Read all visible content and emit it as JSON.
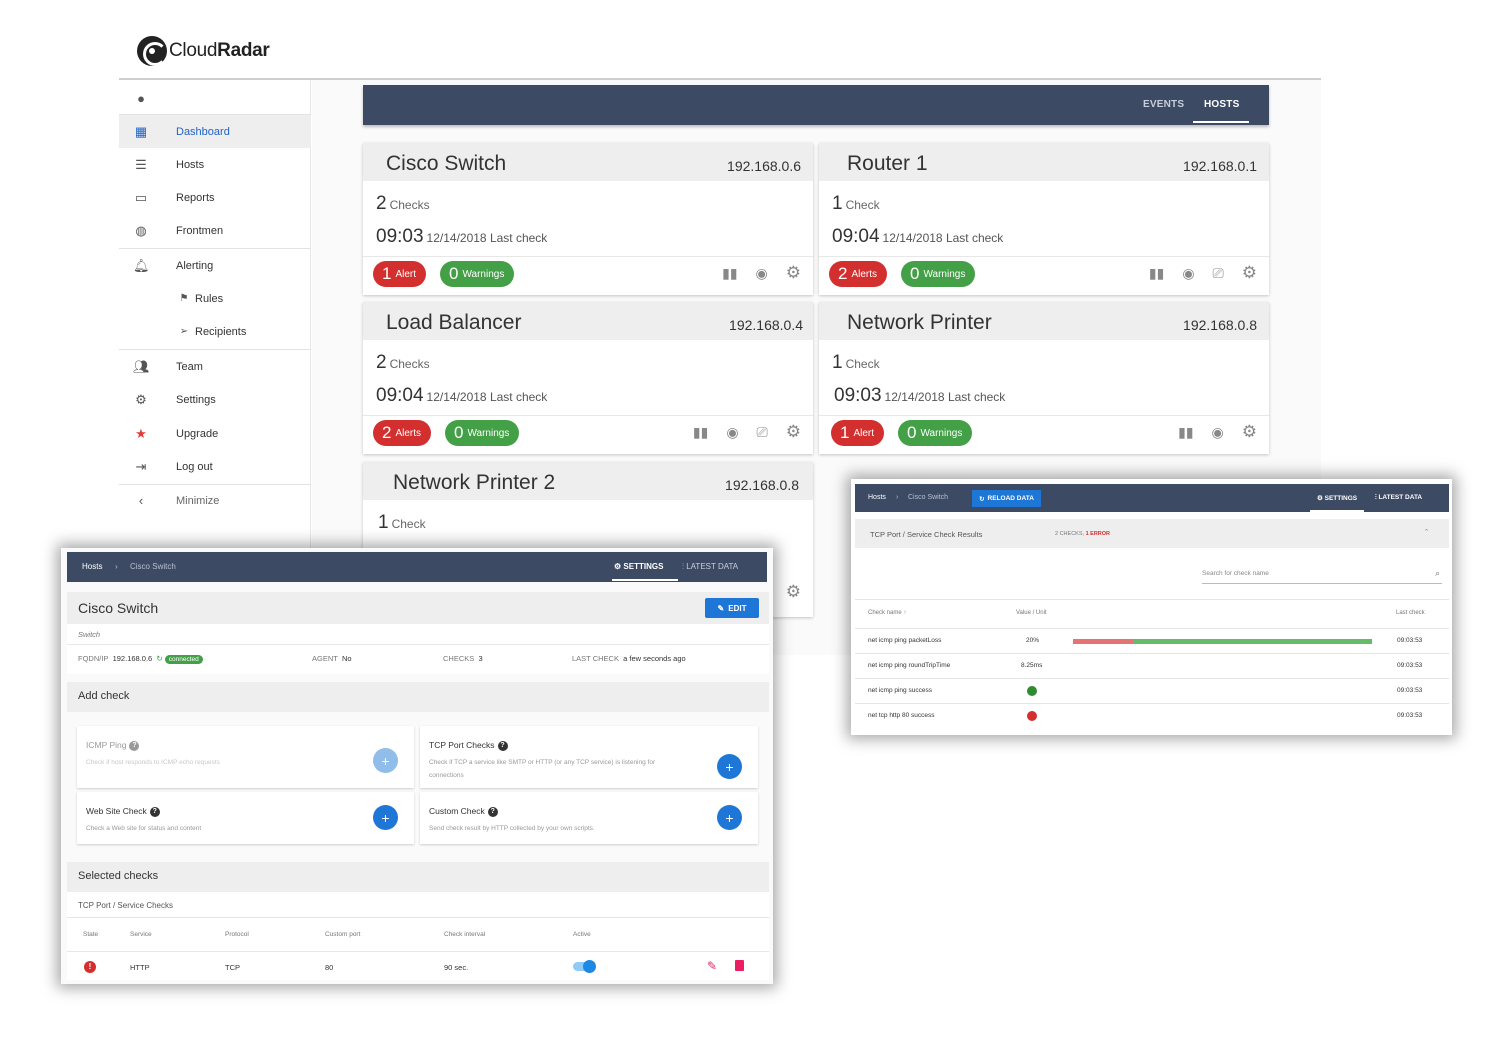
{
  "brand": {
    "name_light": "Cloud",
    "name_bold": "Radar"
  },
  "sidebar": {
    "items": [
      {
        "icon": "account-circle-icon",
        "label": ""
      },
      {
        "icon": "grid-icon",
        "label": "Dashboard"
      },
      {
        "icon": "list-icon",
        "label": "Hosts"
      },
      {
        "icon": "calendar-icon",
        "label": "Reports"
      },
      {
        "icon": "globe-icon",
        "label": "Frontmen"
      },
      {
        "icon": "bell-icon",
        "label": "Alerting"
      },
      {
        "icon": "flag-icon",
        "label": "Rules"
      },
      {
        "icon": "send-icon",
        "label": "Recipients"
      },
      {
        "icon": "people-icon",
        "label": "Team"
      },
      {
        "icon": "gear-icon",
        "label": "Settings"
      },
      {
        "icon": "star-icon",
        "label": "Upgrade"
      },
      {
        "icon": "logout-icon",
        "label": "Log out"
      },
      {
        "icon": "chevron-left-icon",
        "label": "Minimize"
      }
    ]
  },
  "topnav": {
    "events": "EVENTS",
    "hosts": "HOSTS"
  },
  "hosts": [
    {
      "name": "Cisco Switch",
      "ip": "192.168.0.6",
      "checks_n": "2",
      "checks_label": "Checks",
      "time": "09:03",
      "date_label": "12/14/2018 Last check",
      "alerts_n": "1",
      "alerts_label": "Alert",
      "warnings_n": "0",
      "warnings_label": "Warnings"
    },
    {
      "name": "Router 1",
      "ip": "192.168.0.1",
      "checks_n": "1",
      "checks_label": "Check",
      "time": "09:04",
      "date_label": "12/14/2018 Last check",
      "alerts_n": "2",
      "alerts_label": "Alerts",
      "warnings_n": "0",
      "warnings_label": "Warnings"
    },
    {
      "name": "Load Balancer",
      "ip": "192.168.0.4",
      "checks_n": "2",
      "checks_label": "Checks",
      "time": "09:04",
      "date_label": "12/14/2018 Last check",
      "alerts_n": "2",
      "alerts_label": "Alerts",
      "warnings_n": "0",
      "warnings_label": "Warnings"
    },
    {
      "name": "Network Printer",
      "ip": "192.168.0.8",
      "checks_n": "1",
      "checks_label": "Check",
      "time": "09:03",
      "date_label": "12/14/2018 Last check",
      "alerts_n": "1",
      "alerts_label": "Alert",
      "warnings_n": "0",
      "warnings_label": "Warnings"
    },
    {
      "name": "Network Printer 2",
      "ip": "192.168.0.8",
      "checks_n": "1",
      "checks_label": "Check"
    }
  ],
  "detail": {
    "crumb_hosts": "Hosts",
    "crumb_host": "Cisco Switch",
    "tab_settings": "SETTINGS",
    "tab_latest": "LATEST DATA",
    "title": "Cisco Switch",
    "edit": "EDIT",
    "subtitle": "Switch",
    "fqdn_label": "FQDN/IP",
    "fqdn_value": "192.168.0.6",
    "connected": "connected",
    "agent_label": "AGENT",
    "agent_value": "No",
    "checks_label": "CHECKS",
    "checks_value": "3",
    "last_label": "LAST CHECK",
    "last_value": "a few seconds ago",
    "add_check": "Add check",
    "check_types": [
      {
        "title": "ICMP Ping",
        "desc": "Check if host responds to ICMP echo requests"
      },
      {
        "title": "TCP Port Checks",
        "desc": "Check if TCP a service like SMTP or HTTP (or any TCP service) is listening for connections"
      },
      {
        "title": "Web Site Check",
        "desc": "Check a Web site for status and content"
      },
      {
        "title": "Custom Check",
        "desc": "Send check result by HTTP collected by your own scripts."
      }
    ],
    "selected_checks": "Selected checks",
    "group": "TCP Port / Service Checks",
    "columns": [
      "State",
      "Service",
      "Protocol",
      "Custom port",
      "Check interval",
      "Active"
    ],
    "row": {
      "service": "HTTP",
      "protocol": "TCP",
      "port": "80",
      "interval": "90 sec."
    }
  },
  "latest": {
    "crumb_hosts": "Hosts",
    "crumb_host": "Cisco Switch",
    "reload": "RELOAD DATA",
    "tab_settings": "SETTINGS",
    "tab_latest": "LATEST DATA",
    "section": "TCP Port / Service Check Results",
    "summary_checks": "2 CHECKS,",
    "summary_error": "1 ERROR",
    "search_placeholder": "Search for check name",
    "columns": {
      "name": "Check name",
      "value": "Value / Unit",
      "last": "Last check"
    },
    "rows": [
      {
        "name": "net icmp ping packetLoss",
        "value": "20%",
        "time": "09:03:53"
      },
      {
        "name": "net icmp ping roundTripTime",
        "value": "8.25ms",
        "time": "09:03:53"
      },
      {
        "name": "net icmp ping success",
        "value": "",
        "time": "09:03:53",
        "status": "ok"
      },
      {
        "name": "net tcp http 80 success",
        "value": "",
        "time": "09:03:53",
        "status": "error"
      }
    ],
    "packet_loss_fraction": 0.2,
    "colors": {
      "ok": "#2e8b2e",
      "error": "#d32f2f",
      "bar_loss": "#e57373",
      "bar_ok": "#66bb6a"
    }
  }
}
